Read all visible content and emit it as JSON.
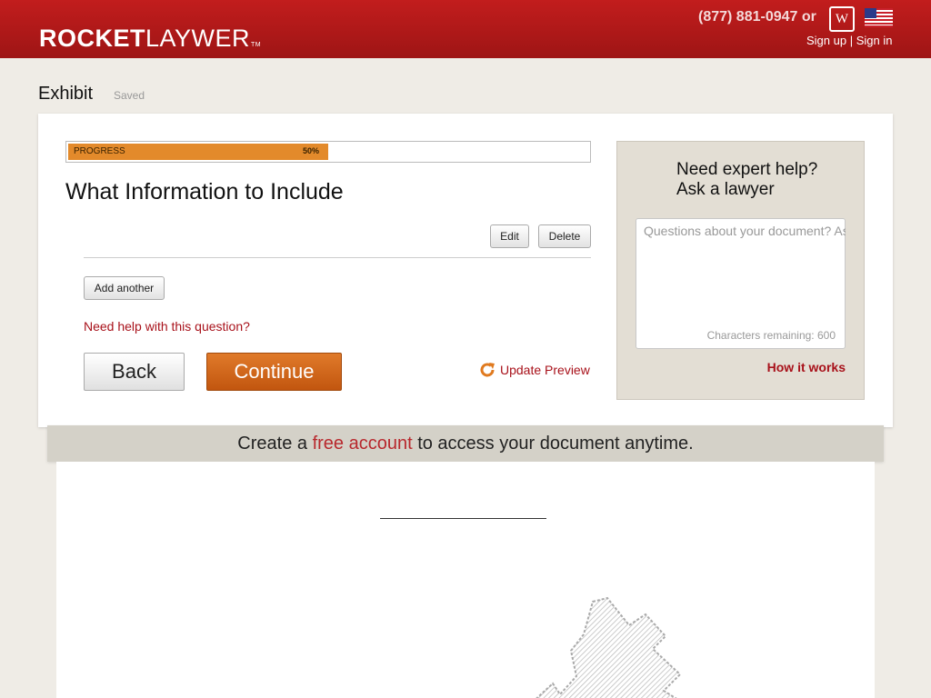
{
  "header": {
    "logo_bold": "ROCKET",
    "logo_light": "LAYWER",
    "logo_tm": "TM",
    "phone": "(877) 881-0947 or",
    "badge_letter": "W",
    "sign_up": "Sign up",
    "separator": " | ",
    "sign_in": "Sign in",
    "icons": {
      "badge": "lawyer-badge-icon",
      "flag": "us-flag-icon"
    }
  },
  "document": {
    "title": "Exhibit",
    "status": "Saved"
  },
  "progress": {
    "label": "PROGRESS",
    "percent_text": "50%",
    "value": 0.5,
    "color": "#e38a2b"
  },
  "question": {
    "title": "What Information to Include",
    "edit_label": "Edit",
    "delete_label": "Delete",
    "add_another_label": "Add another",
    "help_link": "Need help with this question?"
  },
  "nav": {
    "back_label": "Back",
    "continue_label": "Continue",
    "update_preview_label": "Update Preview"
  },
  "expert_panel": {
    "title_line1": "Need expert help?",
    "title_line2": "Ask a lawyer",
    "placeholder": "Questions about your document? Ask a lawyer",
    "chars_remaining": "Characters remaining: 600",
    "how_it_works": "How it works"
  },
  "banner": {
    "prefix": "Create a ",
    "link": "free account",
    "suffix": " to access your document anytime."
  },
  "preview": {
    "blank_line": "________________"
  },
  "colors": {
    "brand_red": "#a8111a",
    "header_red": "#b31a1a",
    "continue_orange": "#d06a1f"
  }
}
